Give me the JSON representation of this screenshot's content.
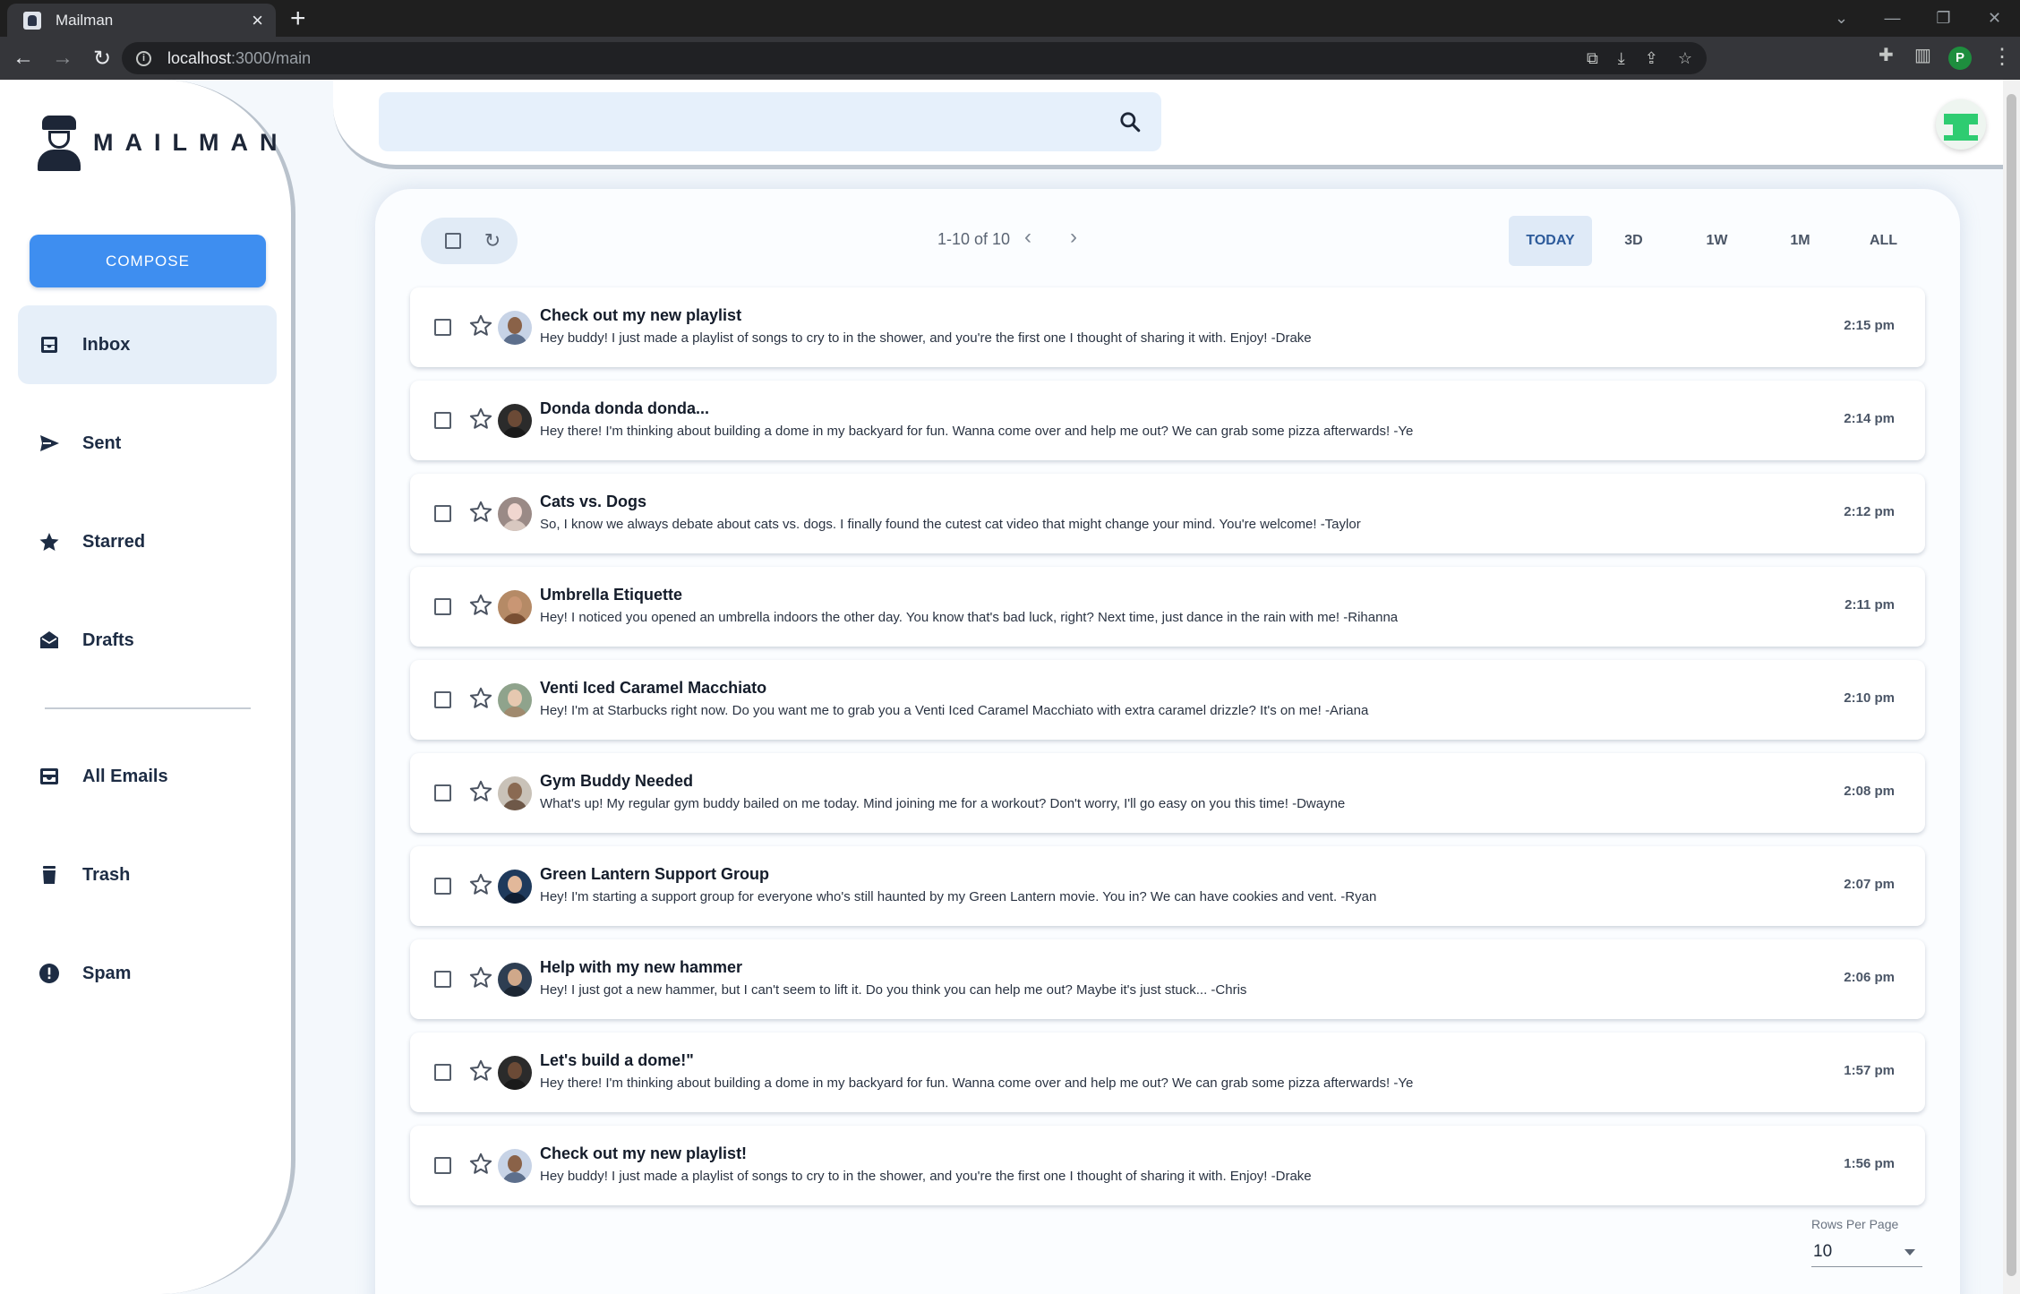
{
  "browser": {
    "tab_title": "Mailman",
    "url_host": "localhost",
    "url_path": ":3000/main",
    "profile_initial": "P"
  },
  "app": {
    "brand": "MAILMAN",
    "compose_label": "COMPOSE",
    "nav": [
      {
        "label": "Inbox",
        "icon": "inbox-icon",
        "active": true
      },
      {
        "label": "Sent",
        "icon": "send-icon"
      },
      {
        "label": "Starred",
        "icon": "star-icon"
      },
      {
        "label": "Drafts",
        "icon": "drafts-icon"
      },
      {
        "label": "All Emails",
        "icon": "all-mail-icon"
      },
      {
        "label": "Trash",
        "icon": "trash-icon"
      },
      {
        "label": "Spam",
        "icon": "spam-icon"
      }
    ],
    "search": {
      "placeholder": ""
    }
  },
  "toolbar": {
    "pagination": "1-10 of 10",
    "filters": [
      "TODAY",
      "3D",
      "1W",
      "1M",
      "ALL"
    ],
    "active_filter": "TODAY"
  },
  "emails": [
    {
      "subject": "Check out my new playlist",
      "preview": "Hey buddy! I just made a playlist of songs to cry to in the shower, and you're the first one I thought of sharing it with. Enjoy! -Drake",
      "time": "2:15 pm"
    },
    {
      "subject": "Donda donda donda...",
      "preview": "Hey there! I'm thinking about building a dome in my backyard for fun. Wanna come over and help me out? We can grab some pizza afterwards! -Ye",
      "time": "2:14 pm"
    },
    {
      "subject": "Cats vs. Dogs",
      "preview": "So, I know we always debate about cats vs. dogs. I finally found the cutest cat video that might change your mind. You're welcome! -Taylor",
      "time": "2:12 pm"
    },
    {
      "subject": "Umbrella Etiquette",
      "preview": "Hey! I noticed you opened an umbrella indoors the other day. You know that's bad luck, right? Next time, just dance in the rain with me! -Rihanna",
      "time": "2:11 pm"
    },
    {
      "subject": "Venti Iced Caramel Macchiato",
      "preview": "Hey! I'm at Starbucks right now. Do you want me to grab you a Venti Iced Caramel Macchiato with extra caramel drizzle? It's on me! -Ariana",
      "time": "2:10 pm"
    },
    {
      "subject": "Gym Buddy Needed",
      "preview": "What's up! My regular gym buddy bailed on me today. Mind joining me for a workout? Don't worry, I'll go easy on you this time! -Dwayne",
      "time": "2:08 pm"
    },
    {
      "subject": "Green Lantern Support Group",
      "preview": "Hey! I'm starting a support group for everyone who's still haunted by my Green Lantern movie. You in? We can have cookies and vent. -Ryan",
      "time": "2:07 pm"
    },
    {
      "subject": "Help with my new hammer",
      "preview": "Hey! I just got a new hammer, but I can't seem to lift it. Do you think you can help me out? Maybe it's just stuck... -Chris",
      "time": "2:06 pm"
    },
    {
      "subject": "Let's build a dome!\"",
      "preview": "Hey there! I'm thinking about building a dome in my backyard for fun. Wanna come over and help me out? We can grab some pizza afterwards! -Ye",
      "time": "1:57 pm"
    },
    {
      "subject": "Check out my new playlist!",
      "preview": "Hey buddy! I just made a playlist of songs to cry to in the shower, and you're the first one I thought of sharing it with. Enjoy! -Drake",
      "time": "1:56 pm"
    }
  ],
  "footer": {
    "rows_per_page_label": "Rows Per Page",
    "rows_per_page_value": "10"
  },
  "colors": {
    "accent": "#3e8ef0",
    "active_nav_bg": "#e6eff9",
    "app_bg": "#f4f8fc",
    "nav_text": "#1d2c44"
  }
}
